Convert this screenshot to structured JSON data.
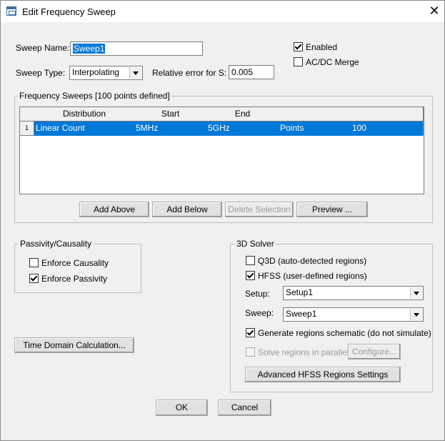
{
  "window": {
    "title": "Edit Frequency Sweep",
    "close_glyph": "✕",
    "icon": "dialog-icon"
  },
  "sweep_name": {
    "label": "Sweep Name:",
    "value": "Sweep1"
  },
  "sweep_type": {
    "label": "Sweep Type:",
    "value": "Interpolating"
  },
  "relative_error": {
    "label": "Relative error for S:",
    "value": "0.005"
  },
  "enabled": {
    "label": "Enabled",
    "checked": true
  },
  "acdc_merge": {
    "label": "AC/DC Merge",
    "checked": false
  },
  "frequency_sweeps": {
    "title": "Frequency Sweeps [100 points defined]",
    "columns": [
      "Distribution",
      "Start",
      "End",
      "",
      ""
    ],
    "rows": [
      {
        "index": "1",
        "cells": [
          "Linear Count",
          "5MHz",
          "5GHz",
          "Points",
          "100"
        ]
      }
    ],
    "buttons": {
      "add_above": "Add Above",
      "add_below": "Add Below",
      "delete_selection": "Delete Selection",
      "preview": "Preview ..."
    }
  },
  "passivity": {
    "title": "Passivity/Causality",
    "enforce_causality": {
      "label": "Enforce Causality",
      "checked": false
    },
    "enforce_passivity": {
      "label": "Enforce Passivity",
      "checked": true
    }
  },
  "time_domain_button": "Time Domain Calculation...",
  "solver_3d": {
    "title": "3D Solver",
    "q3d": {
      "label": "Q3D (auto-detected regions)",
      "checked": false
    },
    "hfss": {
      "label": "HFSS (user-defined regions)",
      "checked": true
    },
    "setup": {
      "label": "Setup:",
      "value": "Setup1"
    },
    "sweep": {
      "label": "Sweep:",
      "value": "Sweep1"
    },
    "generate_schematic": {
      "label": "Generate regions schematic (do not simulate)",
      "checked": true
    },
    "solve_parallel": {
      "label": "Solve regions in parallel",
      "checked": false,
      "disabled": true
    },
    "configure_button": "Configure...",
    "advanced_button": "Advanced HFSS Regions Settings"
  },
  "footer": {
    "ok": "OK",
    "cancel": "Cancel"
  }
}
